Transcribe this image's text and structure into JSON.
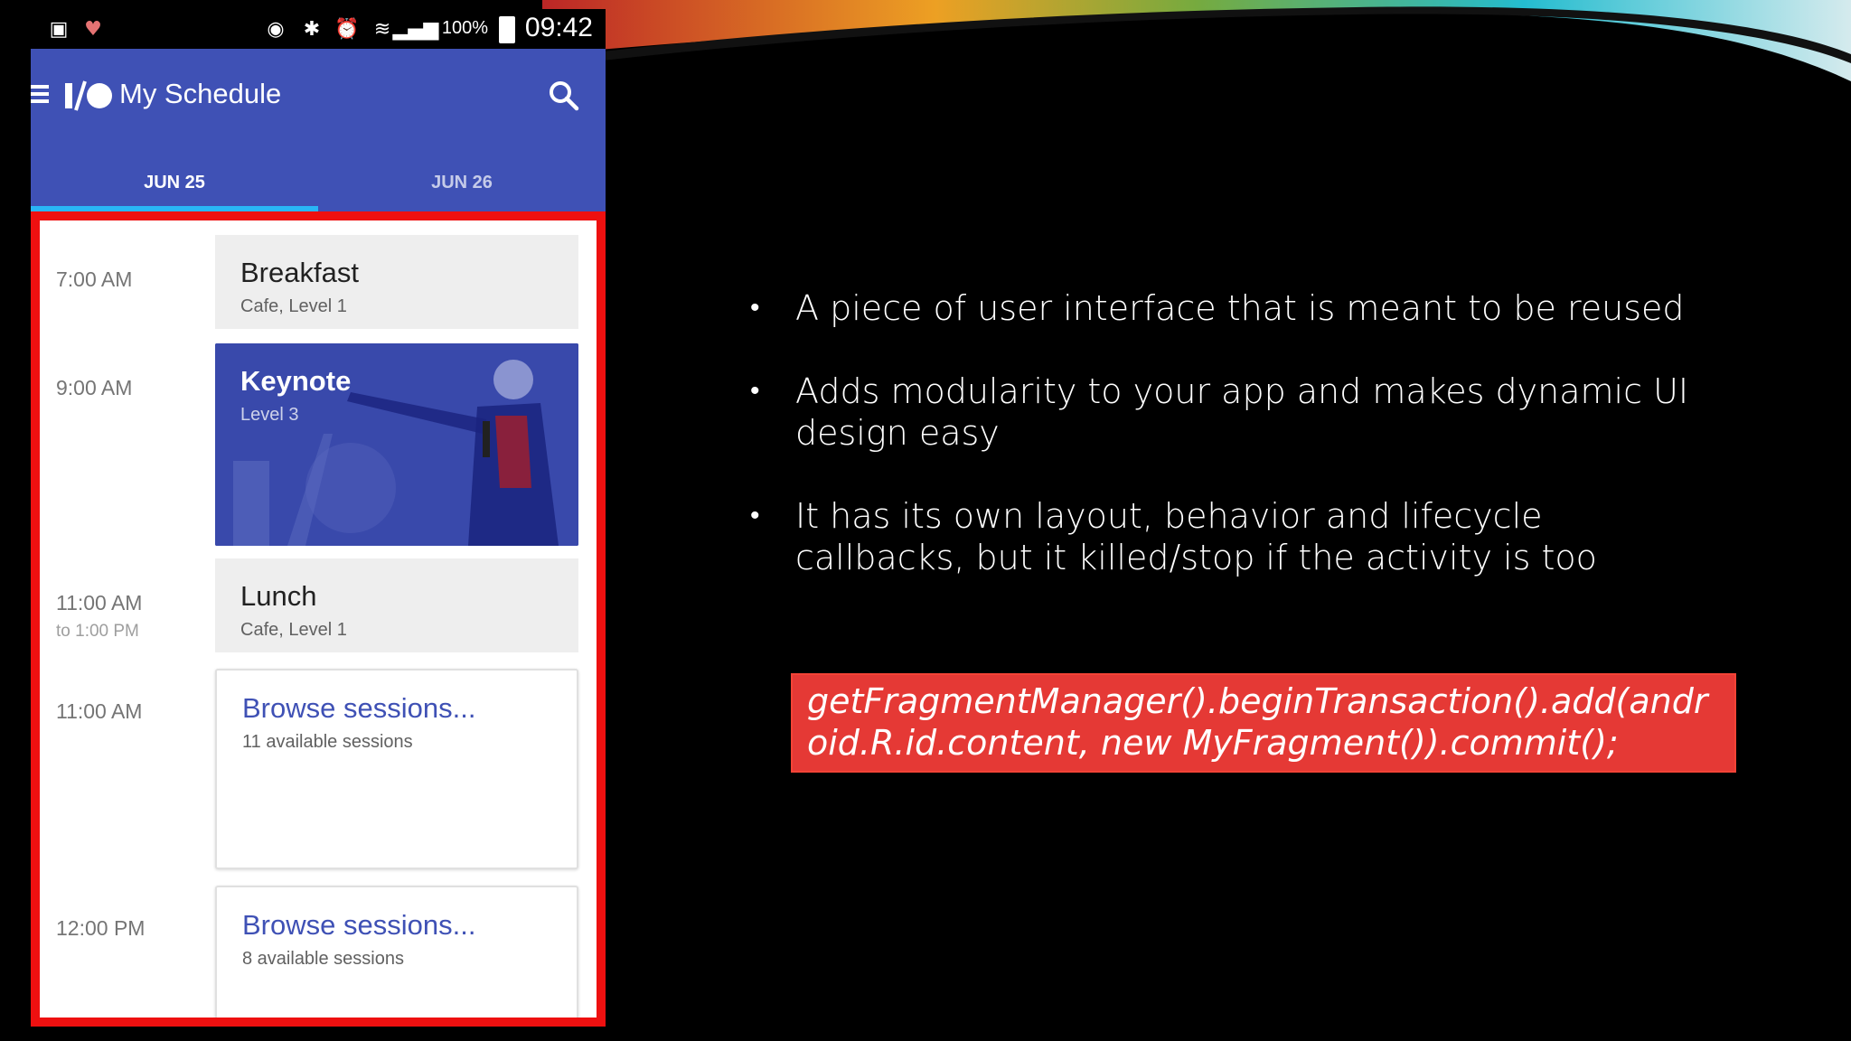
{
  "status_bar": {
    "battery": "100%",
    "time": "09:42"
  },
  "app_bar": {
    "title": "My Schedule",
    "tabs": [
      {
        "label": "JUN 25",
        "selected": true
      },
      {
        "label": "JUN 26",
        "selected": false
      }
    ]
  },
  "schedule": [
    {
      "time": "7:00 AM",
      "time_end": "",
      "title": "Breakfast",
      "subtitle": "Cafe, Level 1",
      "style": "grey"
    },
    {
      "time": "9:00 AM",
      "time_end": "",
      "title": "Keynote",
      "subtitle": "Level 3",
      "style": "image"
    },
    {
      "time": "11:00 AM",
      "time_end": "to 1:00 PM",
      "title": "Lunch",
      "subtitle": "Cafe, Level 1",
      "style": "grey"
    },
    {
      "time": "11:00 AM",
      "time_end": "",
      "title": "Browse sessions...",
      "subtitle": "11 available sessions",
      "style": "outline"
    },
    {
      "time": "12:00 PM",
      "time_end": "",
      "title": "Browse sessions...",
      "subtitle": "8 available sessions",
      "style": "outline"
    }
  ],
  "slide": {
    "bullets": [
      "A piece of user interface that is meant to be reused",
      "Adds modularity to your app and makes dynamic UI design easy",
      "It has its own layout, behavior and lifecycle callbacks, but it killed/stop if the activity is too"
    ],
    "code": "getFragmentManager().beginTransaction().add(android.R.id.content, new MyFragment()).commit();"
  },
  "colors": {
    "app_bar": "#3f51b5",
    "tab_indicator": "#29b6f6",
    "highlight_frame": "#ee1010",
    "code_box": "#e53935"
  }
}
